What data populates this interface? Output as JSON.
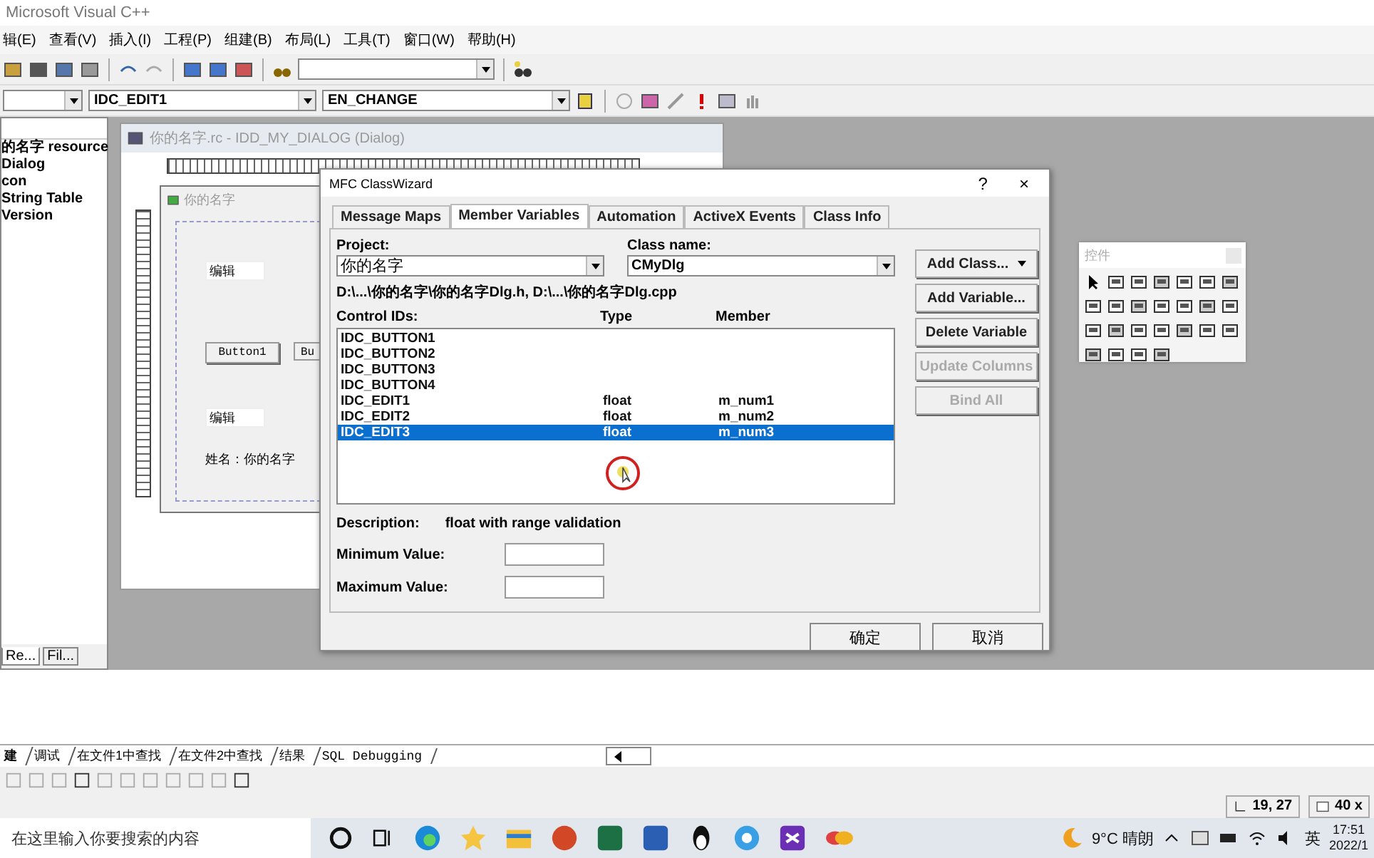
{
  "window": {
    "title": "Microsoft Visual C++"
  },
  "menu": [
    "辑(E)",
    "查看(V)",
    "插入(I)",
    "工程(P)",
    "组建(B)",
    "布局(L)",
    "工具(T)",
    "窗口(W)",
    "帮助(H)"
  ],
  "wizard_bar": {
    "control": "IDC_EDIT1",
    "message": "EN_CHANGE"
  },
  "workspace": {
    "tree": [
      {
        "label": "的名字 resource",
        "children": [
          {
            "label": "Dialog"
          },
          {
            "label": "con"
          },
          {
            "label": "String Table"
          },
          {
            "label": "Version"
          }
        ]
      }
    ],
    "tabs": [
      {
        "label": "Re...",
        "selected": true
      },
      {
        "label": "Fil...",
        "selected": false
      }
    ]
  },
  "editor_window": {
    "title": "你的名字.rc - IDD_MY_DIALOG (Dialog)",
    "dialog": {
      "title": "你的名字",
      "controls": [
        {
          "kind": "edit",
          "text": "编辑"
        },
        {
          "kind": "button",
          "text": "Button1"
        },
        {
          "kind": "button",
          "text": "Bu"
        },
        {
          "kind": "edit",
          "text": "编辑"
        },
        {
          "kind": "static",
          "text": "姓名：你的名字"
        }
      ]
    }
  },
  "class_wizard": {
    "title": "MFC ClassWizard",
    "help": "?",
    "close": "×",
    "tabs": [
      {
        "label": "Message Maps",
        "selected": false
      },
      {
        "label": "Member Variables",
        "selected": true
      },
      {
        "label": "Automation",
        "selected": false
      },
      {
        "label": "ActiveX Events",
        "selected": false
      },
      {
        "label": "Class Info",
        "selected": false
      }
    ],
    "project_label": "Project:",
    "project": "你的名字",
    "class_label": "Class name:",
    "class_name": "CMyDlg",
    "files": "D:\\...\\你的名字\\你的名字Dlg.h, D:\\...\\你的名字Dlg.cpp",
    "columns": [
      "Control IDs:",
      "Type",
      "Member"
    ],
    "rows": [
      {
        "control_id": "IDC_BUTTON1",
        "type": "",
        "member": "",
        "selected": false
      },
      {
        "control_id": "IDC_BUTTON2",
        "type": "",
        "member": "",
        "selected": false
      },
      {
        "control_id": "IDC_BUTTON3",
        "type": "",
        "member": "",
        "selected": false
      },
      {
        "control_id": "IDC_BUTTON4",
        "type": "",
        "member": "",
        "selected": false
      },
      {
        "control_id": "IDC_EDIT1",
        "type": "float",
        "member": "m_num1",
        "selected": false
      },
      {
        "control_id": "IDC_EDIT2",
        "type": "float",
        "member": "m_num2",
        "selected": false
      },
      {
        "control_id": "IDC_EDIT3",
        "type": "float",
        "member": "m_num3",
        "selected": true
      }
    ],
    "description_label": "Description:",
    "description": "float with range validation",
    "min_label": "Minimum Value:",
    "max_label": "Maximum Value:",
    "side_buttons": [
      {
        "label": "Add Class...",
        "dropdown": true,
        "disabled": false
      },
      {
        "label": "Add Variable...",
        "dropdown": false,
        "disabled": false
      },
      {
        "label": "Delete Variable",
        "dropdown": false,
        "disabled": false
      },
      {
        "label": "Update Columns",
        "dropdown": false,
        "disabled": true
      },
      {
        "label": "Bind All",
        "dropdown": false,
        "disabled": true
      }
    ],
    "ok": "确定",
    "cancel": "取消"
  },
  "controls_palette": {
    "title": "控件"
  },
  "output": {
    "tabs": [
      {
        "label": "建",
        "selected": true
      },
      {
        "label": "调试",
        "selected": false
      },
      {
        "label": "在文件1中查找",
        "selected": false
      },
      {
        "label": "在文件2中查找",
        "selected": false
      },
      {
        "label": "结果",
        "selected": false
      },
      {
        "label": "SQL Debugging",
        "selected": false
      }
    ]
  },
  "status_bar": {
    "position": "19, 27",
    "size": "40 x"
  },
  "taskbar": {
    "search_placeholder": "在这里输入你要搜索的内容",
    "weather": "9°C 晴朗",
    "ime": "英",
    "time": "17:51",
    "date": "2022/1"
  }
}
